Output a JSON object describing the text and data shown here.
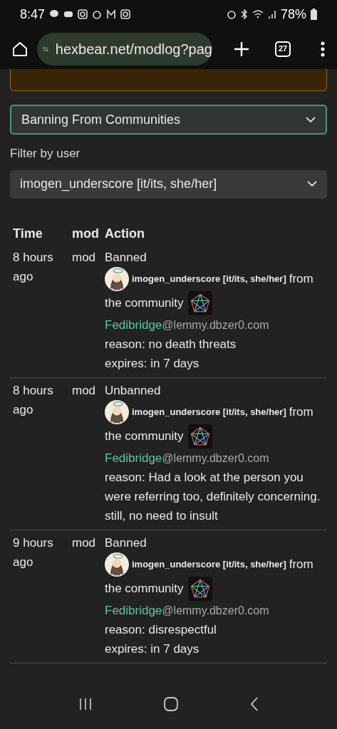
{
  "status_bar": {
    "time": "8:47",
    "battery": "78%"
  },
  "browser": {
    "url": "hexbear.net/modlog?pag",
    "tab_count": "27"
  },
  "filters": {
    "action_select": "Banning From Communities",
    "user_label": "Filter by user",
    "user_select": "imogen_underscore [it/its, she/her]"
  },
  "table": {
    "columns": [
      "Time",
      "mod",
      "Action"
    ],
    "rows": [
      {
        "time": "8 hours ago",
        "mod": "mod",
        "action": "Banned",
        "user": "imogen_underscore [it/its, she/her]",
        "from": "from",
        "community_prefix": "the community",
        "community_name": "Fedibridge",
        "community_instance": "@lemmy.dbzer0.com",
        "reason": "reason: no death threats",
        "expires": "expires: in 7 days"
      },
      {
        "time": "8 hours ago",
        "mod": "mod",
        "action": "Unbanned",
        "user": "imogen_underscore [it/its, she/her]",
        "from": "from",
        "community_prefix": "the community",
        "community_name": "Fedibridge",
        "community_instance": "@lemmy.dbzer0.com",
        "reason": "reason: Had a look at the person you were referring too, definitely concerning. still, no need to insult"
      },
      {
        "time": "9 hours ago",
        "mod": "mod",
        "action": "Banned",
        "user": "imogen_underscore [it/its, she/her]",
        "from": "from",
        "community_prefix": "the community",
        "community_name": "Fedibridge",
        "community_instance": "@lemmy.dbzer0.com",
        "reason": "reason: disrespectful",
        "expires": "expires: in 7 days"
      }
    ]
  }
}
